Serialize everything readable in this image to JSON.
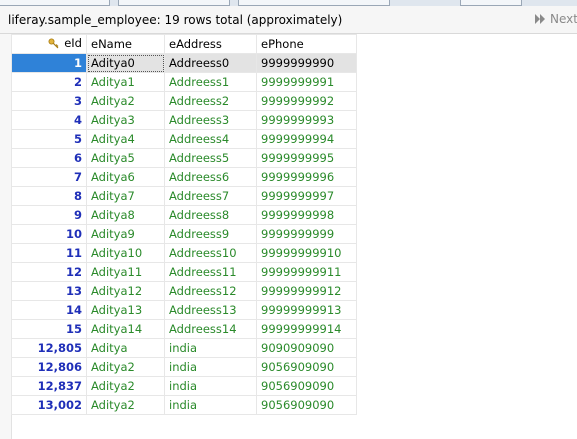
{
  "toolbar": {
    "title": "liferay.sample_employee: 19 rows total (approximately)",
    "next_label": "Next"
  },
  "grid": {
    "columns": [
      "eId",
      "eName",
      "eAddress",
      "ePhone"
    ],
    "rows": [
      [
        "1",
        "Aditya0",
        "Addreess0",
        "9999999990"
      ],
      [
        "2",
        "Aditya1",
        "Addreess1",
        "9999999991"
      ],
      [
        "3",
        "Aditya2",
        "Addreess2",
        "9999999992"
      ],
      [
        "4",
        "Aditya3",
        "Addreess3",
        "9999999993"
      ],
      [
        "5",
        "Aditya4",
        "Addreess4",
        "9999999994"
      ],
      [
        "6",
        "Aditya5",
        "Addreess5",
        "9999999995"
      ],
      [
        "7",
        "Aditya6",
        "Addreess6",
        "9999999996"
      ],
      [
        "8",
        "Aditya7",
        "Addreess7",
        "9999999997"
      ],
      [
        "9",
        "Aditya8",
        "Addreess8",
        "9999999998"
      ],
      [
        "10",
        "Aditya9",
        "Addreess9",
        "9999999999"
      ],
      [
        "11",
        "Aditya10",
        "Addreess10",
        "99999999910"
      ],
      [
        "12",
        "Aditya11",
        "Addreess11",
        "99999999911"
      ],
      [
        "13",
        "Aditya12",
        "Addreess12",
        "99999999912"
      ],
      [
        "14",
        "Aditya13",
        "Addreess13",
        "99999999913"
      ],
      [
        "15",
        "Aditya14",
        "Addreess14",
        "99999999914"
      ],
      [
        "12,805",
        "Aditya",
        "india",
        "9090909090"
      ],
      [
        "12,806",
        "Aditya2",
        "india",
        "9056909090"
      ],
      [
        "12,837",
        "Aditya2",
        "india",
        "9056909090"
      ],
      [
        "13,002",
        "Aditya2",
        "india",
        "9056909090"
      ]
    ],
    "selected_row": 0
  },
  "colors": {
    "id_text": "#1f2fb8",
    "value_text": "#2a8a2a",
    "selection": "#2f82d8",
    "selected_row_bg": "#e3e3e3"
  },
  "icons": {
    "primary_key": "key-icon",
    "next": "next-arrow-icon"
  }
}
